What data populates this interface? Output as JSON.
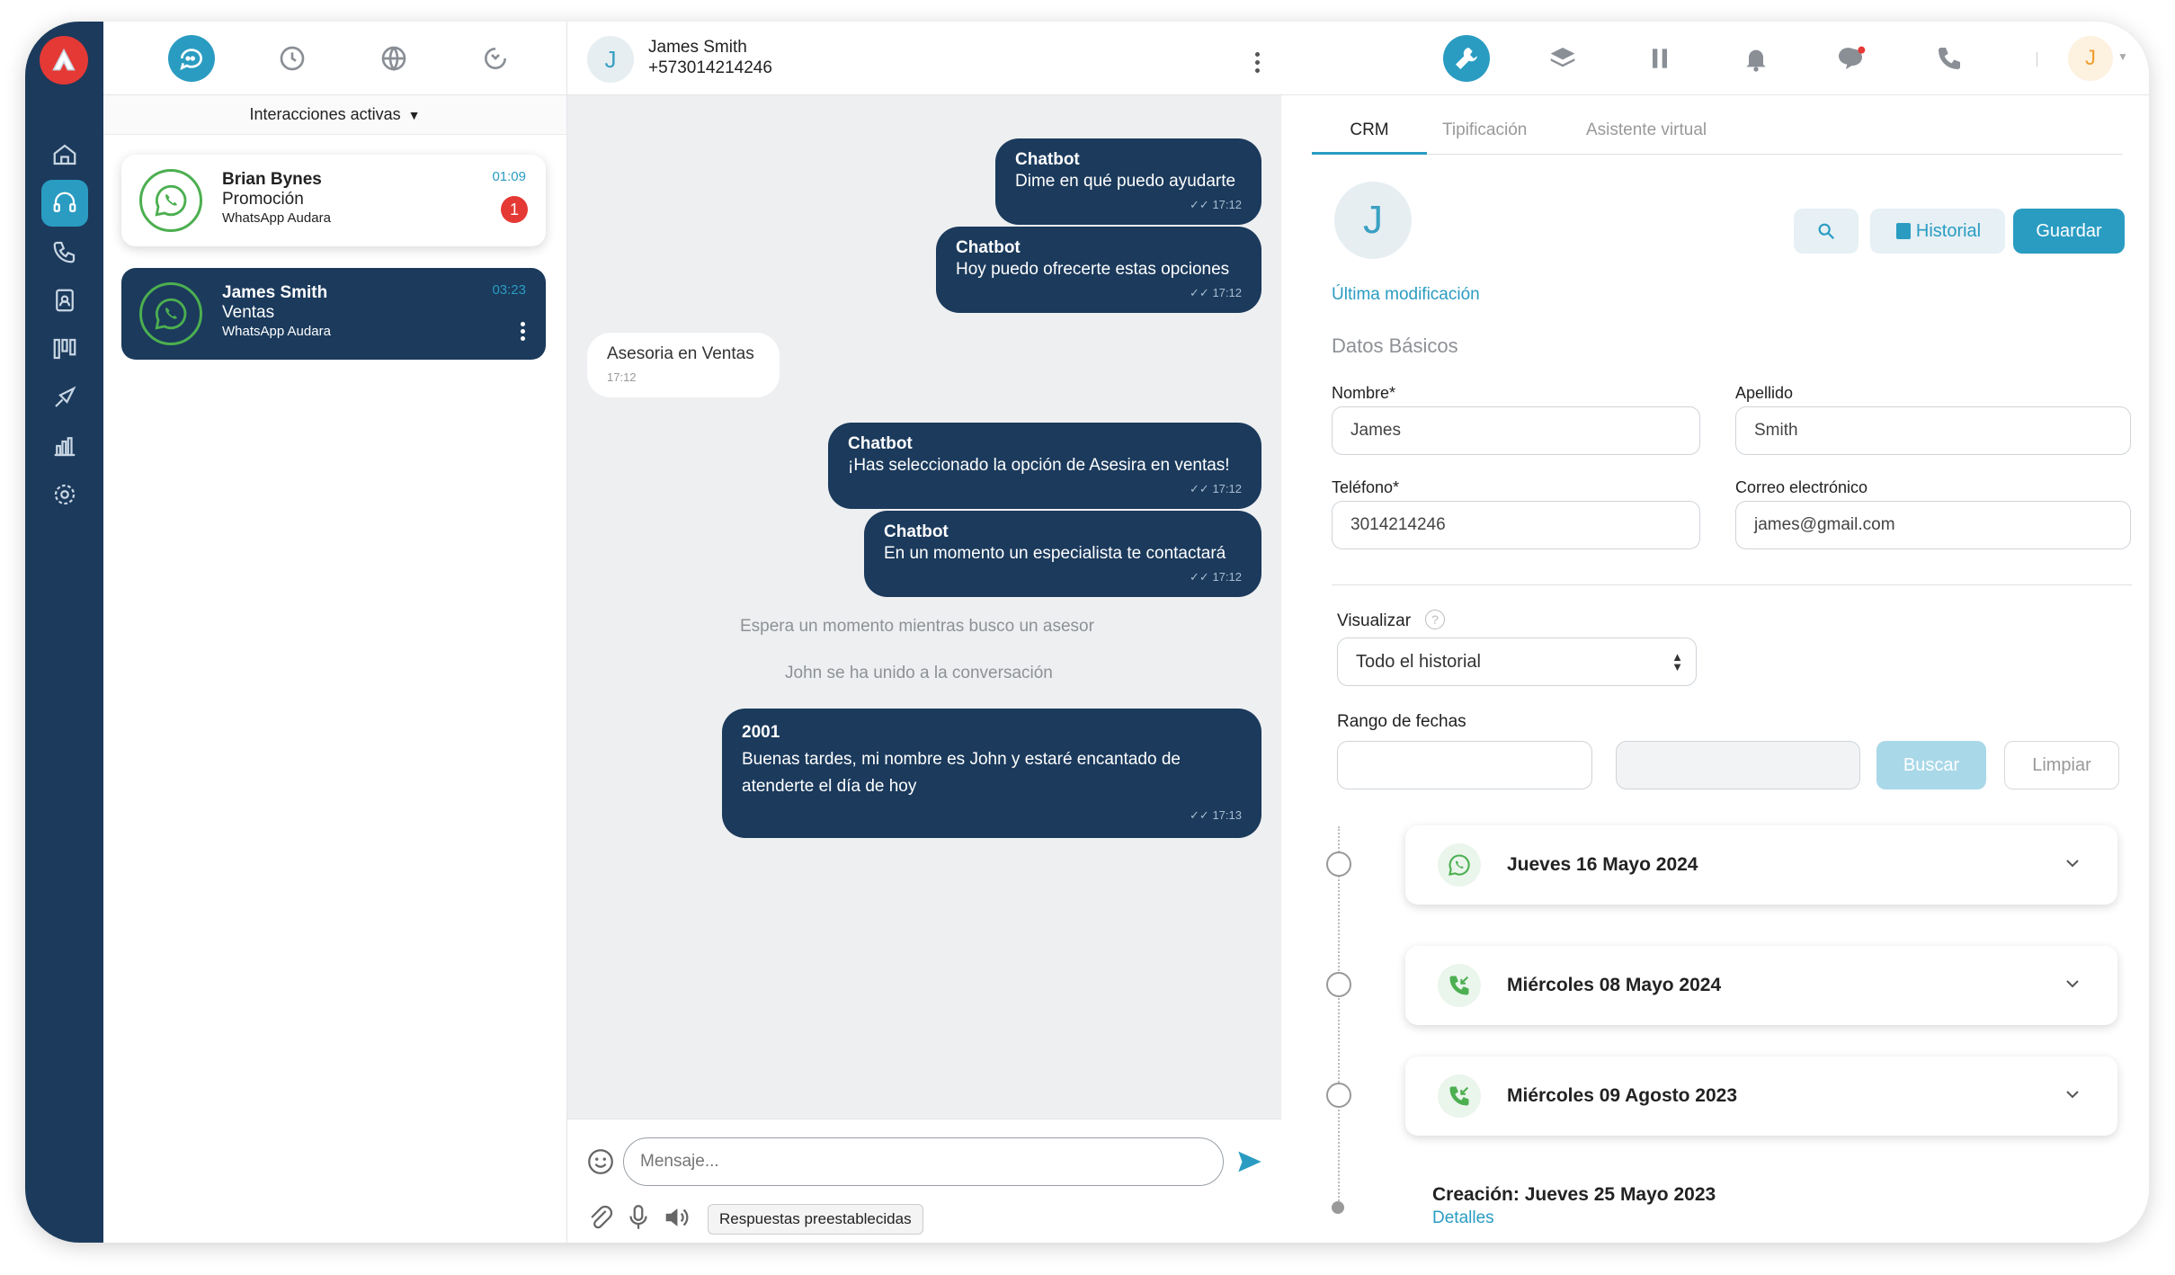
{
  "rail": {
    "items": [
      "home",
      "headset",
      "phone-calls",
      "contacts",
      "kanban",
      "campaigns",
      "reports",
      "settings"
    ]
  },
  "left": {
    "filter_label": "Interacciones activas",
    "conversations": [
      {
        "name": "Brian Bynes",
        "subject": "Promoción",
        "channel": "WhatsApp Audara",
        "time": "01:09",
        "unread": "1"
      },
      {
        "name": "James Smith",
        "subject": "Ventas",
        "channel": "WhatsApp Audara",
        "time": "03:23"
      }
    ]
  },
  "chat": {
    "contact_name": "James Smith",
    "contact_phone": "+573014214246",
    "avatar_letter": "J",
    "messages": [
      {
        "title": "Chatbot",
        "text": "Dime en qué puedo ayudarte",
        "time": "17:12"
      },
      {
        "title": "Chatbot",
        "text": "Hoy puedo ofrecerte estas opciones",
        "time": "17:12"
      },
      {
        "text": "Asesoria en Ventas",
        "time": "17:12"
      },
      {
        "title": "Chatbot",
        "text": "¡Has seleccionado la opción de Asesira en ventas!",
        "time": "17:12"
      },
      {
        "title": "Chatbot",
        "text": "En un momento un especialista te contactará",
        "time": "17:12"
      },
      {
        "title": "2001",
        "text1": "Buenas tardes, mi nombre es John y estaré encantado de",
        "text2": "atenderte el día de hoy",
        "time": "17:13"
      }
    ],
    "system": [
      "Espera un momento mientras busco un asesor",
      "John se ha unido a la conversación"
    ],
    "input_placeholder": "Mensaje...",
    "quick_replies": "Respuestas preestablecidas"
  },
  "right": {
    "user_initial": "J",
    "tabs": [
      "CRM",
      "Tipificación",
      "Asistente virtual"
    ],
    "avatar_letter": "J",
    "history_button": "Historial",
    "save_button": "Guardar",
    "last_modified": "Última modificación",
    "section_title": "Datos Básicos",
    "form": {
      "name_label": "Nombre*",
      "name_value": "James",
      "lastname_label": "Apellido",
      "lastname_value": "Smith",
      "phone_label": "Teléfono*",
      "phone_value": "3014214246",
      "email_label": "Correo electrónico",
      "email_value": "james@gmail.com"
    },
    "visualizar_label": "Visualizar",
    "visualizar_value": "Todo el historial",
    "range_label": "Rango de fechas",
    "search_button": "Buscar",
    "clear_button": "Limpiar",
    "timeline": [
      {
        "date": "Jueves 16 Mayo 2024",
        "channel": "whatsapp"
      },
      {
        "date": "Miércoles 08 Mayo 2024",
        "channel": "call"
      },
      {
        "date": "Miércoles 09 Agosto 2023",
        "channel": "call"
      }
    ],
    "creation": "Creación: Jueves 25 Mayo 2023",
    "details_link": "Detalles"
  },
  "colors": {
    "navy": "#1b3a5c",
    "accent": "#2a9cc2",
    "whatsapp": "#4caf50",
    "alert": "#e53935"
  }
}
